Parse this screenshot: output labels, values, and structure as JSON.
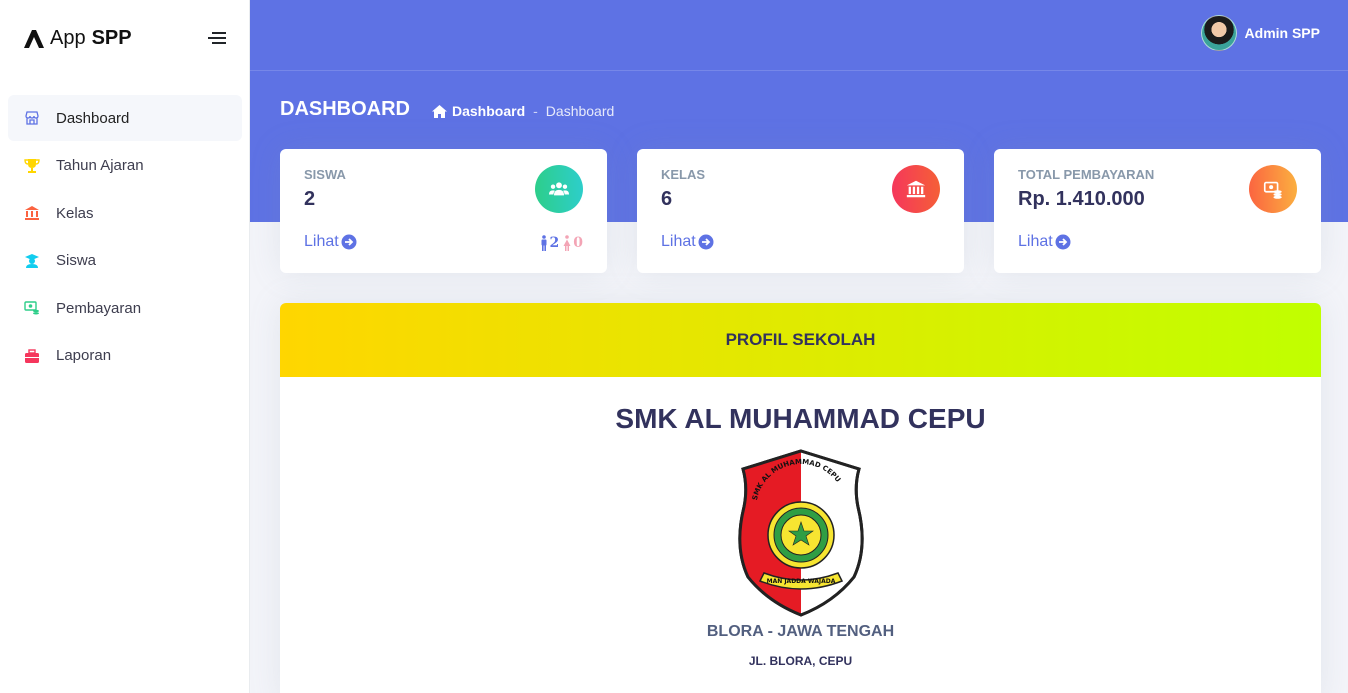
{
  "brand": {
    "app": "App",
    "name": "SPP"
  },
  "sidebar": {
    "items": [
      {
        "label": "Dashboard",
        "icon": "shop-icon",
        "color": "#5e72e4",
        "active": true
      },
      {
        "label": "Tahun Ajaran",
        "icon": "trophy-icon",
        "color": "#ffd600"
      },
      {
        "label": "Kelas",
        "icon": "bank-icon",
        "color": "#fb6340"
      },
      {
        "label": "Siswa",
        "icon": "student-icon",
        "color": "#11cdef"
      },
      {
        "label": "Pembayaran",
        "icon": "money-icon",
        "color": "#2dce89"
      },
      {
        "label": "Laporan",
        "icon": "briefcase-icon",
        "color": "#f5365c"
      }
    ]
  },
  "header": {
    "user_name": "Admin SPP"
  },
  "page": {
    "title": "DASHBOARD",
    "breadcrumb": [
      "Dashboard",
      "Dashboard"
    ]
  },
  "stats": [
    {
      "label": "SISWA",
      "value": "2",
      "link": "Lihat",
      "icon": "users-icon",
      "male_count": "2",
      "female_count": "0"
    },
    {
      "label": "KELAS",
      "value": "6",
      "link": "Lihat",
      "icon": "bank-icon"
    },
    {
      "label": "TOTAL PEMBAYARAN",
      "value": "Rp. 1.410.000",
      "link": "Lihat",
      "icon": "money-coins-icon"
    }
  ],
  "profile": {
    "header": "PROFIL SEKOLAH",
    "school_name": "SMK AL MUHAMMAD CEPU",
    "emblem_text": "SMK AL MUHAMMAD CEPU",
    "motto": "MAN JADDA WAJADA",
    "region": "BLORA - JAWA TENGAH",
    "address": "JL. BLORA, CEPU"
  },
  "colors": {
    "primary": "#5e72e4",
    "accent_yellow": "#ffd600",
    "accent_lime": "#c0ff00"
  }
}
